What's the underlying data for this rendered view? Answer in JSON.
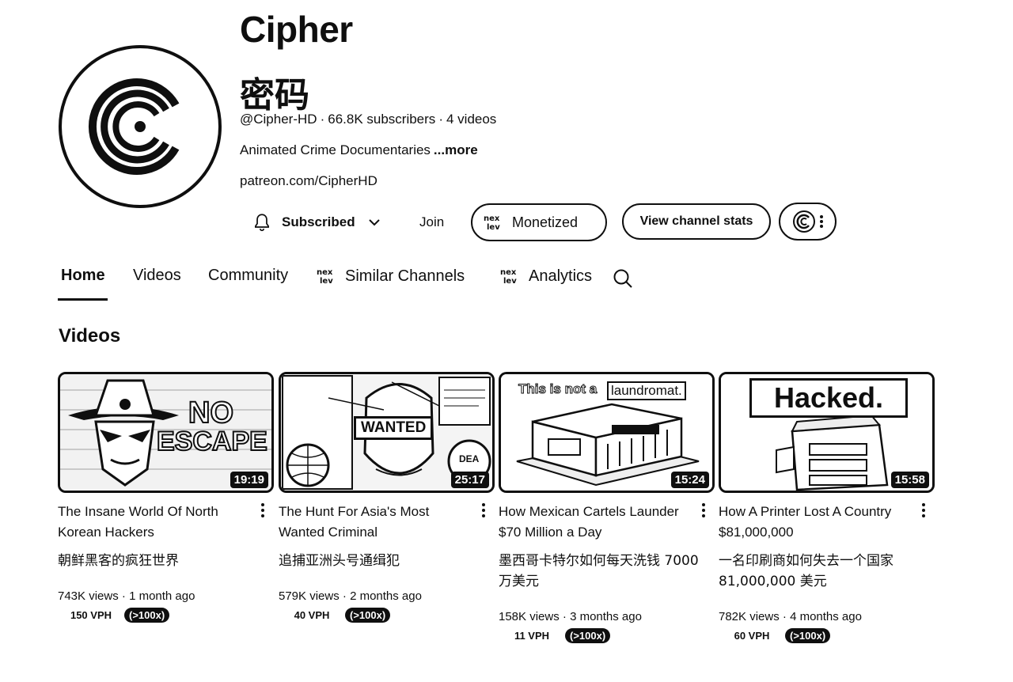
{
  "channel": {
    "name": "Cipher",
    "name_cn": "密码",
    "handle": "@Cipher-HD",
    "subscribers": "66.8K subscribers",
    "video_count": "4 videos",
    "description": "Animated Crime Documentaries",
    "more_label": "...more",
    "link": "patreon.com/CipherHD"
  },
  "actions": {
    "subscribed_label": "Subscribed",
    "join_label": "Join",
    "monetized_label": "Monetized",
    "stats_label": "View channel stats",
    "nexlev_badge": "nex lev"
  },
  "tabs": [
    {
      "label": "Home",
      "active": true
    },
    {
      "label": "Videos"
    },
    {
      "label": "Community"
    },
    {
      "label": "Similar Channels"
    },
    {
      "label": "Analytics"
    }
  ],
  "section_title": "Videos",
  "videos": [
    {
      "title": "The Insane World Of North Korean Hackers",
      "title_cn": "朝鲜黑客的疯狂世界",
      "views": "743K views",
      "age": "1 month ago",
      "duration": "19:19",
      "vph": "150 VPH",
      "badge": "(>100x)",
      "thumb_text": [
        "NO",
        "ESCAPE"
      ]
    },
    {
      "title": "The Hunt For Asia's Most Wanted Criminal",
      "title_cn": "追捕亚洲头号通缉犯",
      "views": "579K views",
      "age": "2 months ago",
      "duration": "25:17",
      "vph": "40 VPH",
      "badge": "(>100x)",
      "thumb_text": [
        "WANTED",
        "DEA"
      ]
    },
    {
      "title": "How Mexican Cartels Launder $70 Million a Day",
      "title_cn": "墨西哥卡特尔如何每天洗钱 7000 万美元",
      "views": "158K views",
      "age": "3 months ago",
      "duration": "15:24",
      "vph": "11 VPH",
      "badge": "(>100x)",
      "thumb_text": [
        "This is not a",
        "laundromat."
      ]
    },
    {
      "title": "How A Printer Lost A Country $81,000,000",
      "title_cn": "一名印刷商如何失去一个国家 81,000,000 美元",
      "views": "782K views",
      "age": "4 months ago",
      "duration": "15:58",
      "vph": "60 VPH",
      "badge": "(>100x)",
      "thumb_text": [
        "Hacked."
      ]
    }
  ],
  "colors": {
    "ink": "#0f0f0f",
    "background": "#ffffff"
  },
  "icons": [
    "cipher-logo-icon",
    "bell-icon",
    "chevron-down-icon",
    "nexlev-icon",
    "search-icon",
    "more-vert-icon"
  ]
}
